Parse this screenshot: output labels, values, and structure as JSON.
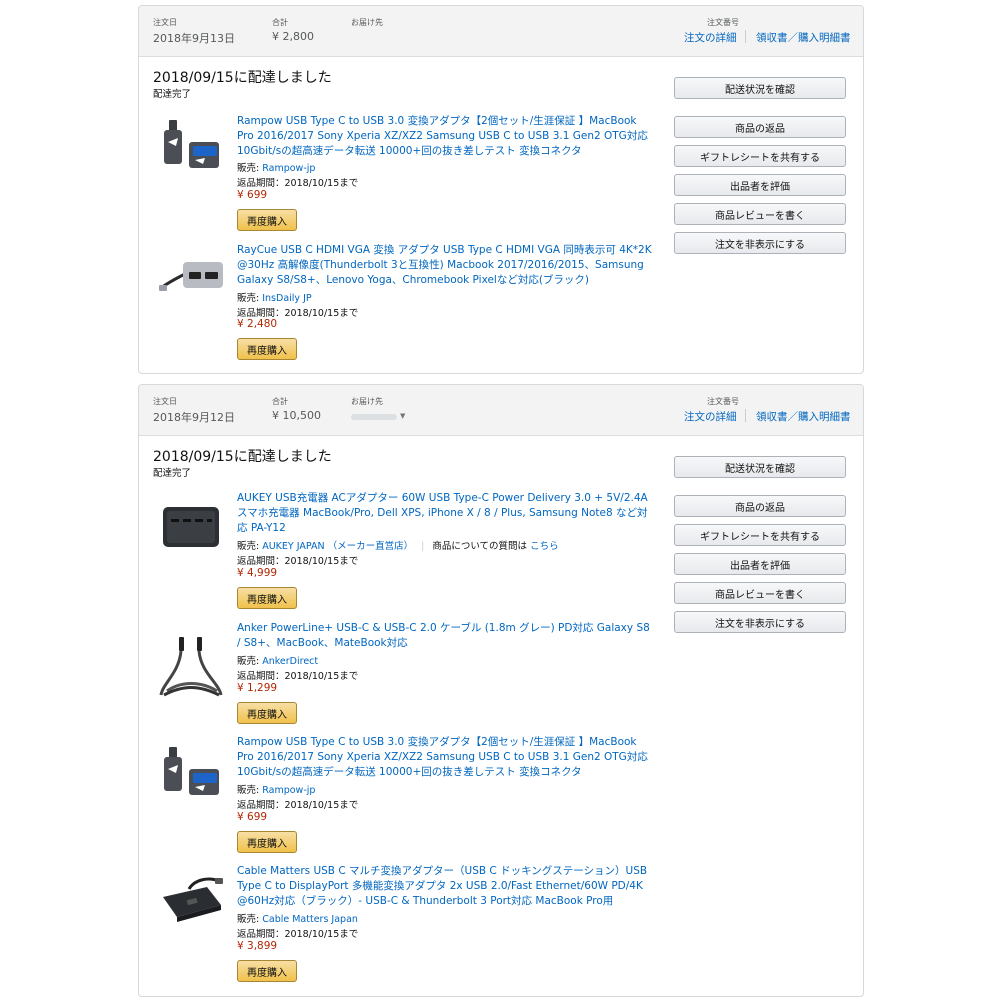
{
  "orders": [
    {
      "order_date_label": "注文日",
      "order_date": "2018年9月13日",
      "total_label": "合計",
      "total": "¥ 2,800",
      "ship_to_label": "お届け先",
      "order_no_label": "注文番号",
      "details_link": "注文の詳細",
      "receipt_link": "領収書／購入明細書",
      "delivery_title": "2018/09/15に配達しました",
      "delivery_status": "配達完了",
      "actions": [
        "配送状況を確認",
        "商品の返品",
        "ギフトレシートを共有する",
        "出品者を評価",
        "商品レビューを書く",
        "注文を非表示にする"
      ],
      "items": [
        {
          "title": "Rampow USB Type C to USB 3.0 変換アダプタ【2個セット/生涯保証 】MacBook Pro 2016/2017 Sony Xperia XZ/XZ2 Samsung USB C to USB 3.1 Gen2 OTG対応 10Gbit/sの超高速データ転送 10000+回の抜き差しテスト 変換コネクタ",
          "seller_label": "販売: ",
          "seller": "Rampow-jp",
          "return": "返品期間：2018/10/15まで",
          "price": "¥ 699",
          "buy_again": "再度購入",
          "image": "usb-c-to-usb-a-adapter"
        },
        {
          "title": "RayCue USB C HDMI VGA 変換 アダプタ USB Type C HDMI VGA 同時表示可 4K*2K @30Hz 高解像度(Thunderbolt 3と互換性) Macbook 2017/2016/2015、Samsung Galaxy S8/S8+、Lenovo Yoga、Chromebook Pixelなど対応(ブラック)",
          "seller_label": "販売: ",
          "seller": "InsDaily JP",
          "return": "返品期間：2018/10/15まで",
          "price": "¥ 2,480",
          "buy_again": "再度購入",
          "image": "usb-c-hdmi-vga-adapter"
        }
      ]
    },
    {
      "order_date_label": "注文日",
      "order_date": "2018年9月12日",
      "total_label": "合計",
      "total": "¥ 10,500",
      "ship_to_label": "お届け先",
      "order_no_label": "注文番号",
      "details_link": "注文の詳細",
      "receipt_link": "領収書／購入明細書",
      "delivery_title": "2018/09/15に配達しました",
      "delivery_status": "配達完了",
      "actions": [
        "配送状況を確認",
        "商品の返品",
        "ギフトレシートを共有する",
        "出品者を評価",
        "商品レビューを書く",
        "注文を非表示にする"
      ],
      "items": [
        {
          "title": "AUKEY USB充電器 ACアダプター 60W USB Type-C Power Delivery 3.0 + 5V/2.4A スマホ充電器 MacBook/Pro, Dell XPS, iPhone X / 8 / Plus, Samsung Note8 など対応 PA-Y12",
          "seller_label": "販売: ",
          "seller": "AUKEY JAPAN （メーカー直営店）",
          "question_label": "商品についての質問は",
          "question_link": "こちら",
          "return": "返品期間：2018/10/15まで",
          "price": "¥ 4,999",
          "buy_again": "再度購入",
          "image": "usb-charger"
        },
        {
          "title": "Anker PowerLine+ USB-C & USB-C 2.0 ケーブル (1.8m グレー) PD対応 Galaxy S8 / S8+、MacBook、MateBook対応",
          "seller_label": "販売: ",
          "seller": "AnkerDirect",
          "return": "返品期間：2018/10/15まで",
          "price": "¥ 1,299",
          "buy_again": "再度購入",
          "image": "usb-c-cable"
        },
        {
          "title": "Rampow USB Type C to USB 3.0 変換アダプタ【2個セット/生涯保証 】MacBook Pro 2016/2017 Sony Xperia XZ/XZ2 Samsung USB C to USB 3.1 Gen2 OTG対応 10Gbit/sの超高速データ転送 10000+回の抜き差しテスト 変換コネクタ",
          "seller_label": "販売: ",
          "seller": "Rampow-jp",
          "return": "返品期間：2018/10/15まで",
          "price": "¥ 699",
          "buy_again": "再度購入",
          "image": "usb-c-to-usb-a-adapter"
        },
        {
          "title": "Cable Matters USB C マルチ変換アダプター（USB C ドッキングステーション）USB Type C to DisplayPort 多機能変換アダプタ 2x USB 2.0/Fast Ethernet/60W PD/4K @60Hz対応（ブラック）- USB-C & Thunderbolt 3 Port対応 MacBook Pro用",
          "seller_label": "販売: ",
          "seller": "Cable Matters Japan",
          "return": "返品期間：2018/10/15まで",
          "price": "¥ 3,899",
          "buy_again": "再度購入",
          "image": "usb-c-docking-station"
        }
      ]
    }
  ],
  "colors": {
    "link": "#0066c0",
    "price": "#b12704",
    "buy_button": "#f0c14b",
    "header_bg": "#f3f3f3"
  }
}
